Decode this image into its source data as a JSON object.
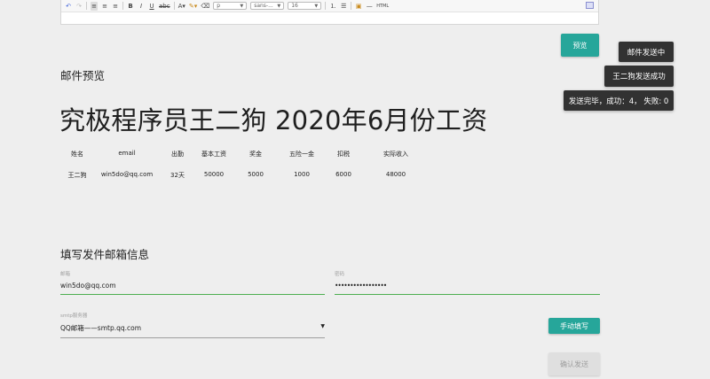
{
  "toolbar": {
    "format_value": "p",
    "font_value": "sans-...",
    "size_value": "16"
  },
  "actions": {
    "preview_label": "预览",
    "manual_fill_label": "手动填写",
    "confirm_send_label": "确认发送"
  },
  "toasts": [
    "邮件发送中",
    "王二狗发送成功",
    "发送完毕，成功：4， 失败: 0"
  ],
  "preview": {
    "section_title": "邮件预览",
    "heading": "究极程序员王二狗 2020年6月份工资",
    "table": {
      "headers": [
        "姓名",
        "email",
        "出勤",
        "基本工资",
        "奖金",
        "五险一金",
        "扣税",
        "实际收入"
      ],
      "rows": [
        [
          "王二狗",
          "win5do@qq.com",
          "32天",
          "50000",
          "5000",
          "1000",
          "6000",
          "48000"
        ]
      ]
    }
  },
  "form": {
    "title": "填写发件邮箱信息",
    "email_label": "邮箱",
    "email_value": "win5do@qq.com",
    "password_label": "密码",
    "password_value": "•••••••••••••••••",
    "smtp_label": "smtp服务器",
    "smtp_value": "QQ邮箱——smtp.qq.com"
  },
  "colors": {
    "accent": "#26a69a",
    "toast_bg": "#323232",
    "field_focus_line": "#4caf50",
    "page_bg": "#eeeeee"
  }
}
